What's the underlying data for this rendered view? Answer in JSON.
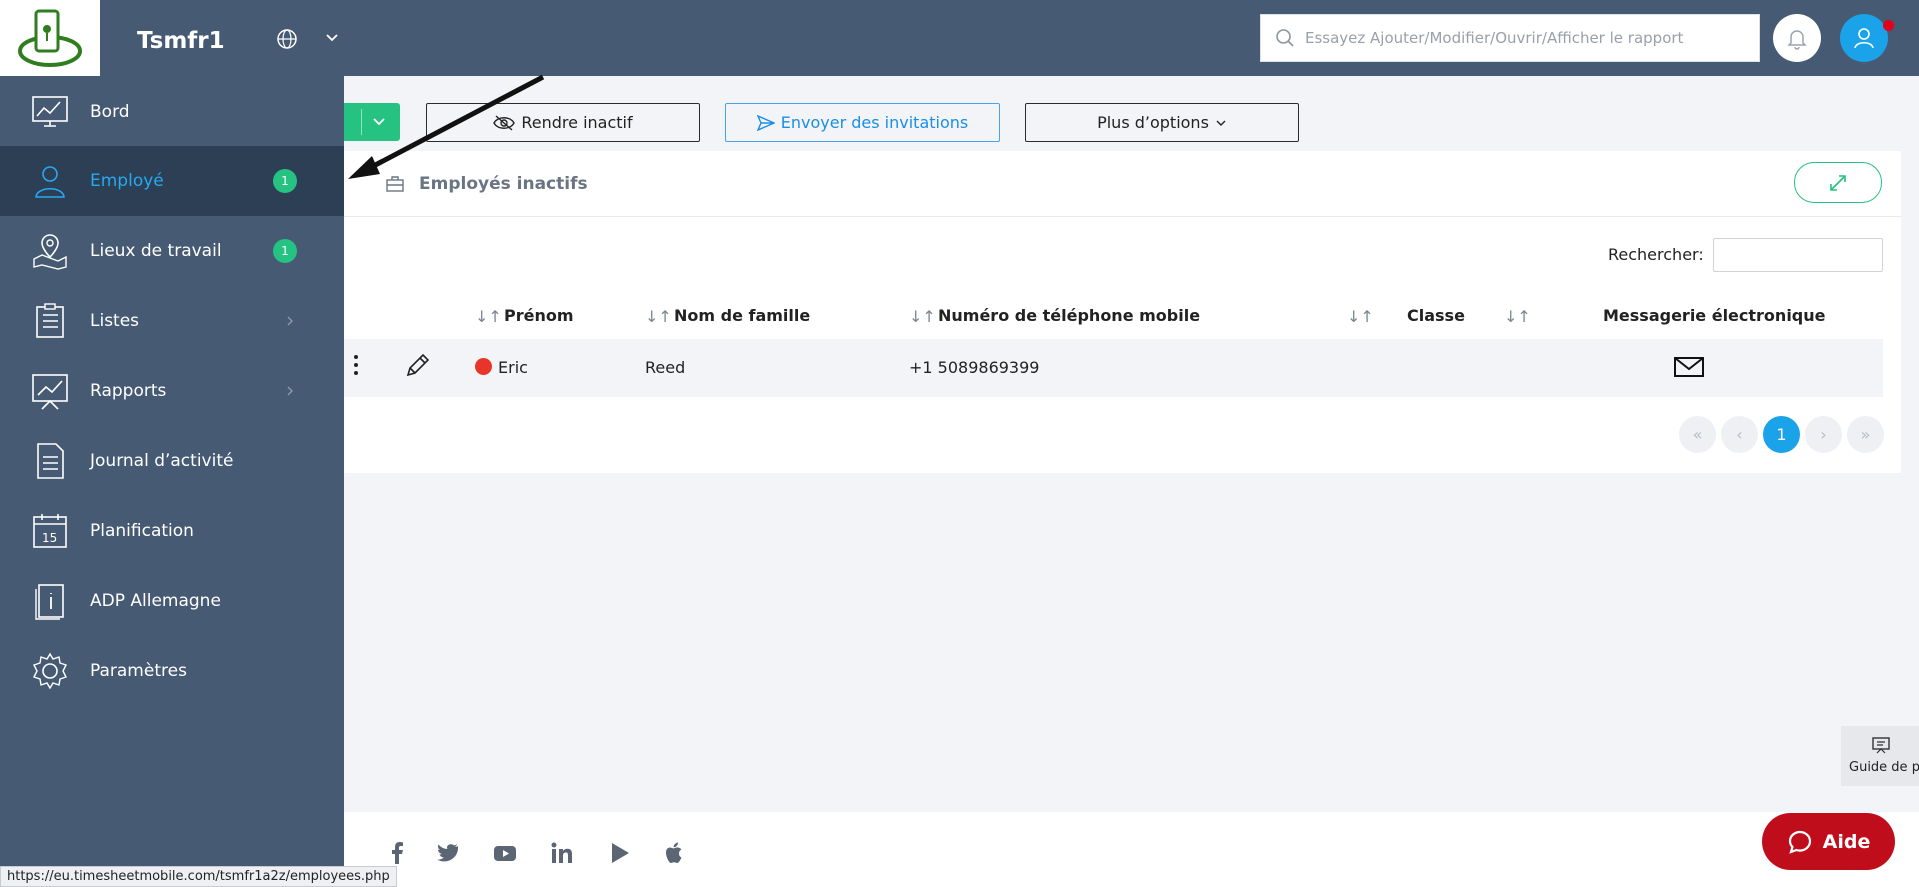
{
  "header": {
    "brand": "Tsmfr1",
    "search_placeholder": "Essayez Ajouter/Modifier/Ouvrir/Afficher le rapport"
  },
  "sidebar": {
    "items": [
      {
        "label": "Bord",
        "icon": "dashboard-icon"
      },
      {
        "label": "Employé",
        "icon": "employee-icon",
        "badge": "1",
        "active": true
      },
      {
        "label": "Lieux de travail",
        "icon": "map-pin-icon",
        "badge": "1"
      },
      {
        "label": "Listes",
        "icon": "clipboard-list-icon",
        "chevron": true
      },
      {
        "label": "Rapports",
        "icon": "report-chart-icon",
        "chevron": true
      },
      {
        "label": "Journal d’activité",
        "icon": "document-icon"
      },
      {
        "label": "Planification",
        "icon": "calendar-icon"
      },
      {
        "label": "ADP Allemagne",
        "icon": "info-book-icon"
      },
      {
        "label": "Paramètres",
        "icon": "gear-icon"
      }
    ]
  },
  "toolbar": {
    "deactivate_label": "Rendre inactif",
    "invite_label": "Envoyer des invitations",
    "more_label": "Plus d’options"
  },
  "card": {
    "title": "Employés inactifs",
    "search_label": "Rechercher:"
  },
  "table": {
    "columns": [
      "Prénom",
      "Nom de famille",
      "Numéro de téléphone mobile",
      "Classe",
      "Messagerie électronique"
    ],
    "rows": [
      {
        "first": "Eric",
        "last": "Reed",
        "phone": "+1 5089869399",
        "class": "",
        "email_icon": "mail-icon"
      }
    ]
  },
  "pagination": {
    "current": "1",
    "first": "«",
    "prev": "‹",
    "next": "›",
    "last": "»"
  },
  "guide": {
    "label": "Guide de p"
  },
  "help": {
    "label": "Aide"
  },
  "status_url": "https://eu.timesheetmobile.com/tsmfr1a2z/employees.php",
  "colors": {
    "header_bg": "#465a73",
    "sidebar_active": "#2c3f54",
    "accent_blue": "#1aa3e8",
    "badge_green": "#26c281",
    "help_red": "#c00d1c"
  }
}
